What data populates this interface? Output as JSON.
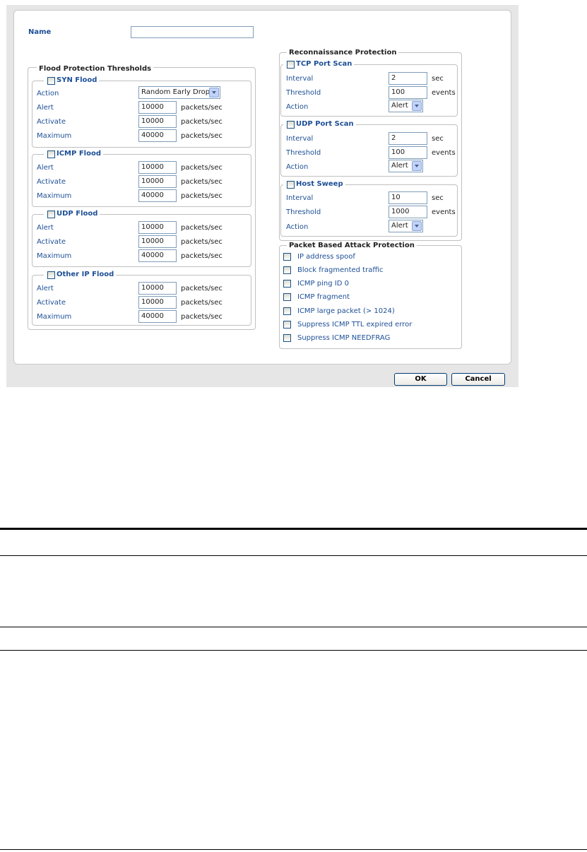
{
  "name": {
    "label": "Name",
    "value": ""
  },
  "flood": {
    "title": "Flood Protection Thresholds",
    "syn": {
      "title": "SYN Flood",
      "action_label": "Action",
      "action_value": "Random Early Drop",
      "alert_label": "Alert",
      "alert_value": "10000",
      "activate_label": "Activate",
      "activate_value": "10000",
      "maximum_label": "Maximum",
      "maximum_value": "40000",
      "unit": "packets/sec"
    },
    "icmp": {
      "title": "ICMP Flood",
      "alert_label": "Alert",
      "alert_value": "10000",
      "activate_label": "Activate",
      "activate_value": "10000",
      "maximum_label": "Maximum",
      "maximum_value": "40000",
      "unit": "packets/sec"
    },
    "udp": {
      "title": "UDP Flood",
      "alert_label": "Alert",
      "alert_value": "10000",
      "activate_label": "Activate",
      "activate_value": "10000",
      "maximum_label": "Maximum",
      "maximum_value": "40000",
      "unit": "packets/sec"
    },
    "other": {
      "title": "Other IP Flood",
      "alert_label": "Alert",
      "alert_value": "10000",
      "activate_label": "Activate",
      "activate_value": "10000",
      "maximum_label": "Maximum",
      "maximum_value": "40000",
      "unit": "packets/sec"
    }
  },
  "recon": {
    "title": "Reconnaissance Protection",
    "tcp": {
      "title": "TCP Port Scan",
      "interval_label": "Interval",
      "interval_value": "2",
      "interval_unit": "sec",
      "threshold_label": "Threshold",
      "threshold_value": "100",
      "threshold_unit": "events",
      "action_label": "Action",
      "action_value": "Alert"
    },
    "udp": {
      "title": "UDP Port Scan",
      "interval_label": "Interval",
      "interval_value": "2",
      "interval_unit": "sec",
      "threshold_label": "Threshold",
      "threshold_value": "100",
      "threshold_unit": "events",
      "action_label": "Action",
      "action_value": "Alert"
    },
    "host": {
      "title": "Host Sweep",
      "interval_label": "Interval",
      "interval_value": "10",
      "interval_unit": "sec",
      "threshold_label": "Threshold",
      "threshold_value": "1000",
      "threshold_unit": "events",
      "action_label": "Action",
      "action_value": "Alert"
    }
  },
  "packet": {
    "title": "Packet Based Attack Protection",
    "items": [
      "IP address spoof",
      "Block fragmented traffic",
      "ICMP ping ID 0",
      "ICMP fragment",
      "ICMP large packet (> 1024)",
      "Suppress ICMP TTL expired error",
      "Suppress ICMP NEEDFRAG"
    ]
  },
  "buttons": {
    "ok": "OK",
    "cancel": "Cancel"
  },
  "colors": {
    "label_blue": "#1d4f96",
    "frame_gray": "#e6e6e6",
    "input_border": "#7f9db9"
  }
}
